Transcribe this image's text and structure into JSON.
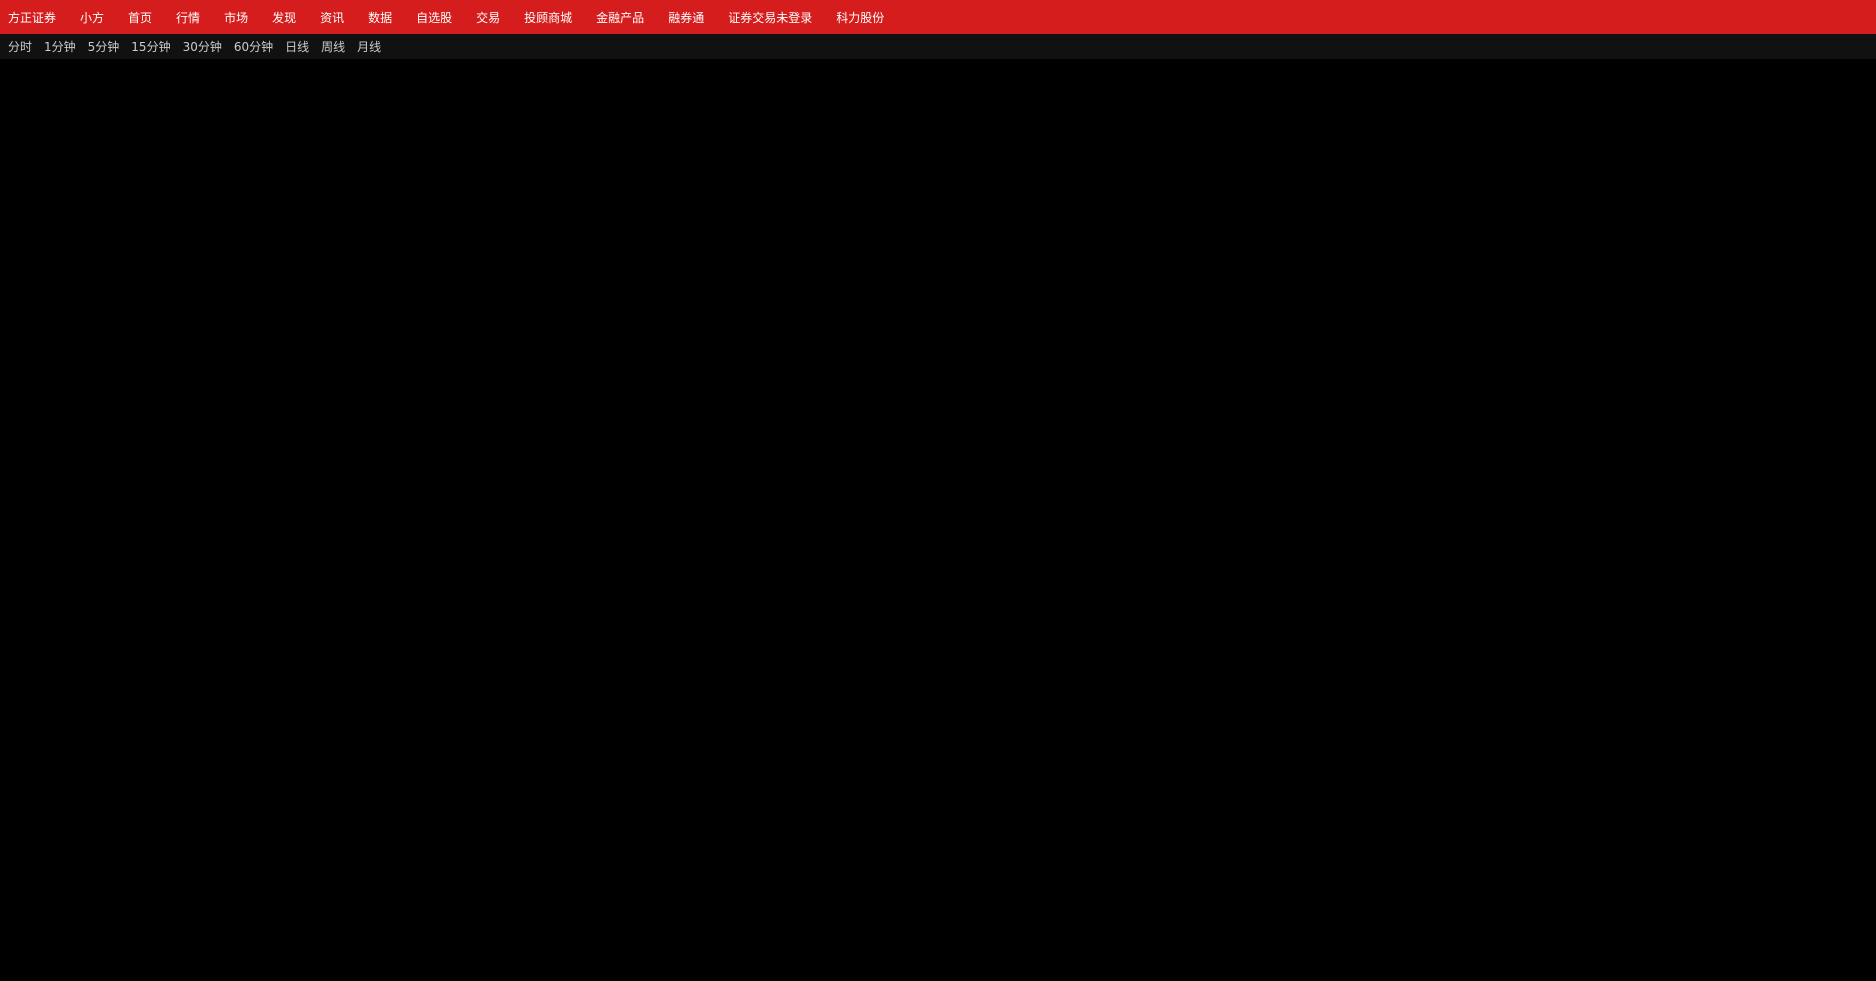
{
  "app": {
    "brand": "方正证券",
    "sub": "小方"
  },
  "topbar": {
    "menu": [
      "首页",
      "行情",
      "市场",
      "发现",
      "资讯",
      "数据",
      "自选股",
      "交易",
      "投顾商城",
      "金融产品",
      "融券通"
    ],
    "status": "证券交易未登录",
    "stock": "科力股份"
  },
  "periods": [
    "分时",
    "1分钟",
    "5分钟",
    "15分钟",
    "30分钟",
    "60分钟",
    "日线",
    "周线",
    "月线"
  ]
}
